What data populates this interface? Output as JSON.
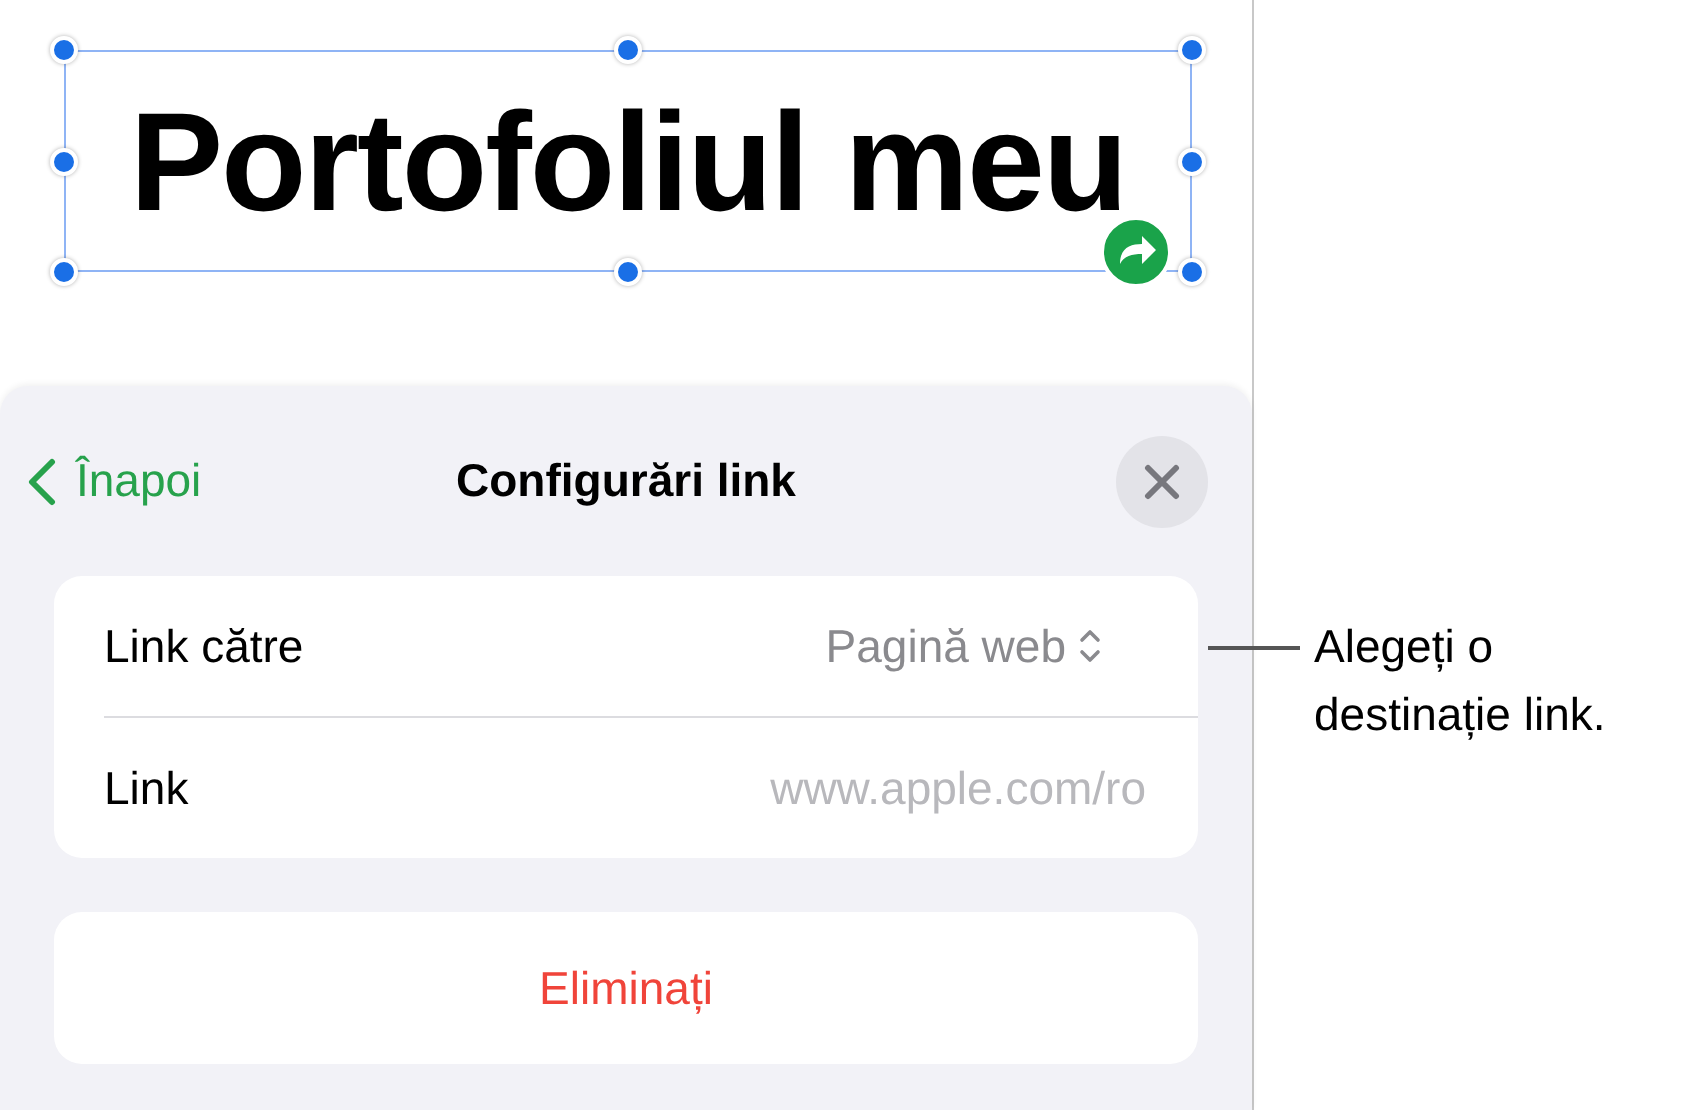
{
  "canvas": {
    "text_box": {
      "text": "Portofoliul meu",
      "selected": true
    }
  },
  "sheet": {
    "back": "Înapoi",
    "title": "Configurări link",
    "rows": [
      {
        "kind": "popup",
        "label": "Link către",
        "value": "Pagină web"
      },
      {
        "kind": "field",
        "label": "Link",
        "placeholder": "www.apple.com/ro"
      }
    ],
    "remove_button": "Eliminați"
  },
  "callout": "Alegeți o destinație link."
}
